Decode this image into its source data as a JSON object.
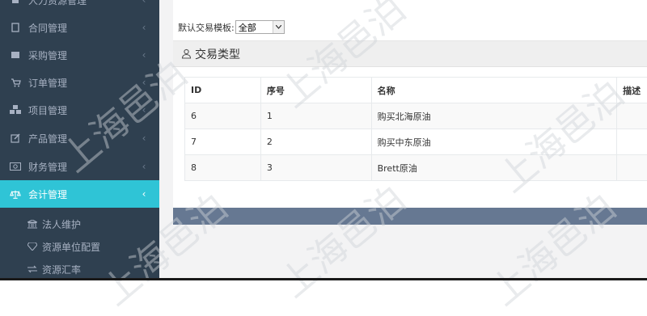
{
  "sidebar": {
    "items": [
      {
        "label": "人力资源管理",
        "icon": "user-icon"
      },
      {
        "label": "合同管理",
        "icon": "document-icon"
      },
      {
        "label": "采购管理",
        "icon": "box-icon"
      },
      {
        "label": "订单管理",
        "icon": "cart-icon"
      },
      {
        "label": "项目管理",
        "icon": "cubes-icon"
      },
      {
        "label": "产品管理",
        "icon": "edit-icon"
      },
      {
        "label": "财务管理",
        "icon": "money-icon"
      },
      {
        "label": "会计管理",
        "icon": "balance-scale-icon"
      }
    ],
    "sub_items": [
      {
        "label": "法人维护",
        "icon": "bank-icon"
      },
      {
        "label": "资源单位配置",
        "icon": "diamond-icon"
      },
      {
        "label": "资源汇率",
        "icon": "exchange-icon"
      }
    ],
    "chevron": "‹",
    "colors": {
      "bg": "#2f4050",
      "active": "#2fc4d6"
    }
  },
  "template": {
    "label": "默认交易模板:",
    "selected": "全部"
  },
  "section": {
    "title": "交易类型"
  },
  "table": {
    "columns": [
      "ID",
      "序号",
      "名称",
      "描述"
    ],
    "rows": [
      [
        "6",
        "1",
        "购买北海原油",
        ""
      ],
      [
        "7",
        "2",
        "购买中东原油",
        ""
      ],
      [
        "8",
        "3",
        "Brett原油",
        ""
      ]
    ]
  },
  "watermark": "上海邑泊"
}
